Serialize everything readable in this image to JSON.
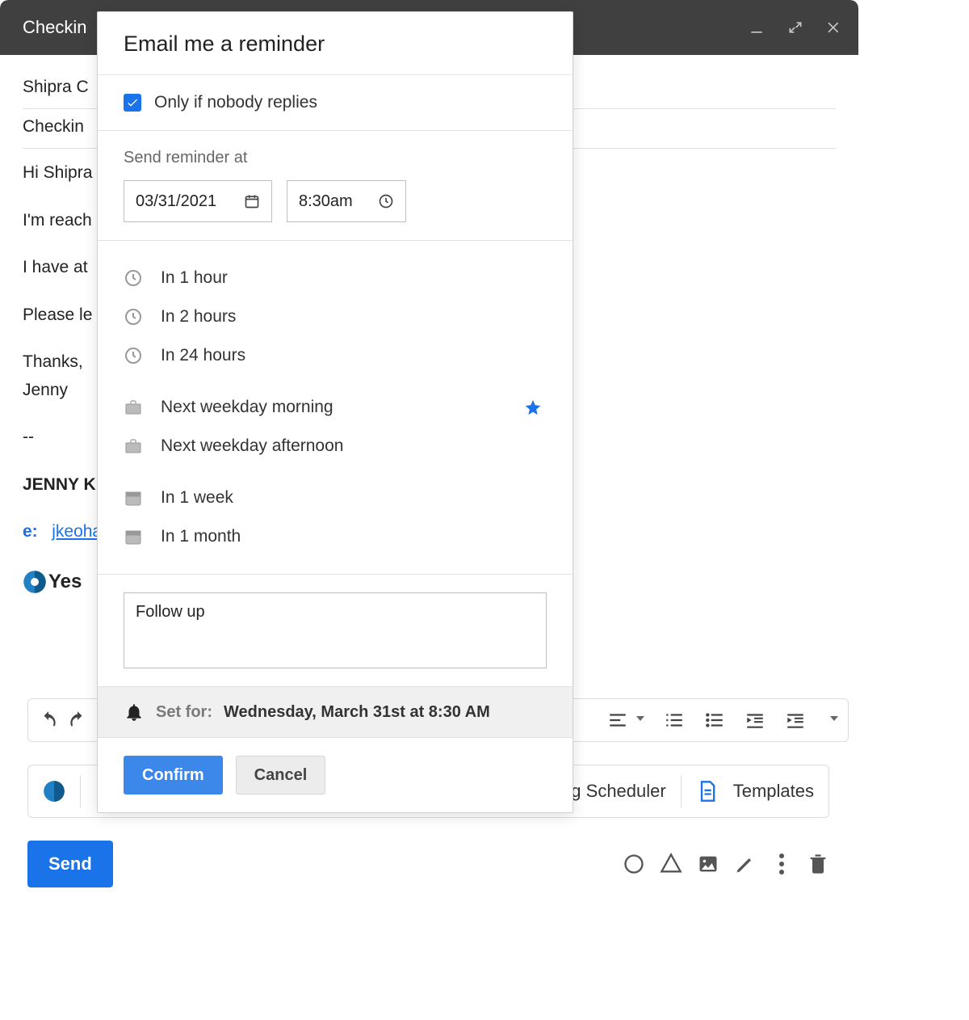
{
  "window": {
    "title": "Checkin"
  },
  "compose": {
    "to": "Shipra C",
    "subject": "Checkin",
    "body_lines": [
      "Hi Shipra",
      "I'm reach",
      "I have at",
      "Please le",
      "Thanks,",
      "Jenny"
    ],
    "sig_sep": "--",
    "sig_name": "JENNY K",
    "sig_email_label": "e:",
    "sig_email_value": "jkeoha",
    "sig_brand": "Yes"
  },
  "ext_toolbar": {
    "scheduler": "g Scheduler",
    "templates": "Templates"
  },
  "send_button": "Send",
  "modal": {
    "title": "Email me a reminder",
    "only_if_nobody_label": "Only if nobody replies",
    "send_at_label": "Send reminder at",
    "date_value": "03/31/2021",
    "time_value": "8:30am",
    "quick": {
      "in_1_hour": "In 1 hour",
      "in_2_hours": "In 2 hours",
      "in_24_hours": "In 24 hours",
      "next_wd_morning": "Next weekday morning",
      "next_wd_afternoon": "Next weekday afternoon",
      "in_1_week": "In 1 week",
      "in_1_month": "In 1 month"
    },
    "note_value": "Follow up",
    "set_for_label": "Set for:",
    "set_for_value": "Wednesday, March 31st at 8:30 AM",
    "confirm": "Confirm",
    "cancel": "Cancel"
  }
}
